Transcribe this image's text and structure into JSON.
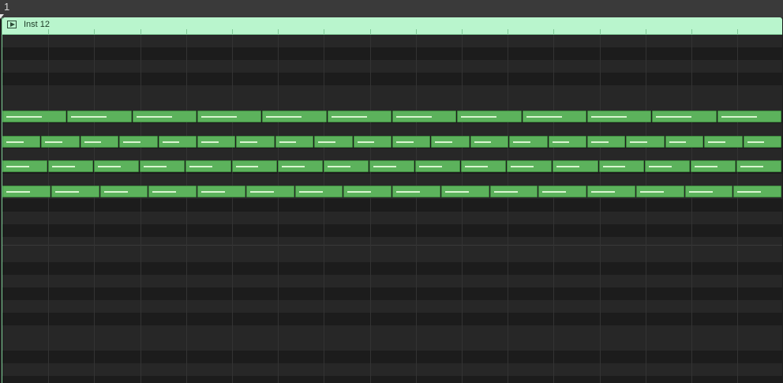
{
  "ruler": {
    "bar_label": "1"
  },
  "region": {
    "name": "Inst 12",
    "color": "#b9f5cd",
    "icon": "play-region-icon"
  },
  "note_color": "#5cb25c",
  "note_rows": [
    {
      "notes_per_bar": 12,
      "velocity": 0.62
    },
    {
      "notes_per_bar": 20,
      "velocity": 0.55
    },
    {
      "notes_per_bar": 17,
      "velocity": 0.6
    },
    {
      "notes_per_bar": 16,
      "velocity": 0.58
    }
  ]
}
